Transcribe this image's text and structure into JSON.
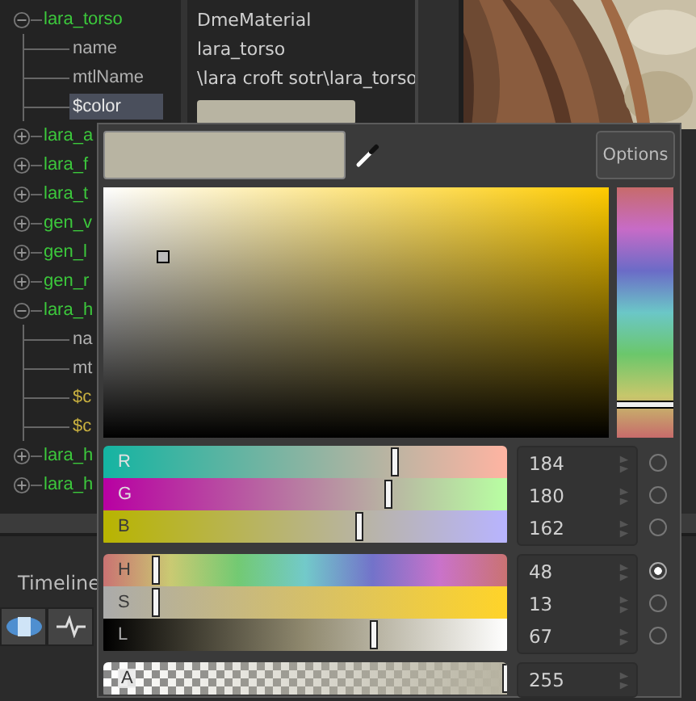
{
  "tree": [
    {
      "label": "lara_torso",
      "expanded": true,
      "selected": false,
      "children": [
        {
          "label": "name",
          "kind": "field",
          "selected": false
        },
        {
          "label": "mtlName",
          "kind": "field",
          "selected": false
        },
        {
          "label": "$color",
          "kind": "param",
          "selected": true
        }
      ]
    },
    {
      "label": "lara_a",
      "expanded": false,
      "selected": false
    },
    {
      "label": "lara_f",
      "expanded": false,
      "selected": false
    },
    {
      "label": "lara_t",
      "expanded": false,
      "selected": false
    },
    {
      "label": "gen_v",
      "expanded": false,
      "selected": false
    },
    {
      "label": "gen_l",
      "expanded": false,
      "selected": false
    },
    {
      "label": "gen_r",
      "expanded": false,
      "selected": false
    },
    {
      "label": "lara_h",
      "expanded": true,
      "selected": false,
      "children": [
        {
          "label": "na",
          "kind": "field",
          "selected": false
        },
        {
          "label": "mt",
          "kind": "field",
          "selected": false
        },
        {
          "label": "$c",
          "kind": "param",
          "selected": false
        },
        {
          "label": "$c",
          "kind": "param",
          "selected": false
        }
      ]
    },
    {
      "label": "lara_h",
      "expanded": false,
      "selected": false
    },
    {
      "label": "lara_h",
      "expanded": false,
      "selected": false
    }
  ],
  "values": [
    {
      "kind": "text",
      "text": "DmeMaterial"
    },
    {
      "kind": "text",
      "text": "lara_torso"
    },
    {
      "kind": "text",
      "text": "\\lara croft sotr\\lara_torso"
    },
    {
      "kind": "swatch"
    }
  ],
  "timeline": {
    "label": "Timeline"
  },
  "color_picker": {
    "options_button": "Options",
    "groups": [
      {
        "sliders": [
          {
            "kind": "red",
            "label": "R",
            "value": "184",
            "level": 0.722,
            "selected": false
          },
          {
            "kind": "green",
            "label": "G",
            "value": "180",
            "level": 0.706,
            "selected": false
          },
          {
            "kind": "blue",
            "label": "B",
            "value": "162",
            "level": 0.635,
            "selected": false
          }
        ]
      },
      {
        "sliders": [
          {
            "kind": "hue",
            "label": "H",
            "value": "48",
            "level": 0.133,
            "selected": true
          },
          {
            "kind": "saturation",
            "label": "S",
            "value": "13",
            "level": 0.13,
            "selected": false
          },
          {
            "kind": "lightness",
            "label": "L",
            "value": "67",
            "level": 0.67,
            "selected": false
          }
        ]
      },
      {
        "sliders": [
          {
            "kind": "alpha",
            "label": "A",
            "value": "255",
            "level": 1.0
          }
        ]
      }
    ]
  }
}
